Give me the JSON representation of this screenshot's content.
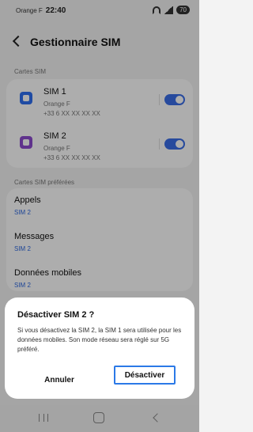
{
  "status_bar": {
    "carrier": "Orange F",
    "time": "22:40",
    "battery": "70"
  },
  "header": {
    "title": "Gestionnaire SIM"
  },
  "sections": {
    "sim_cards_label": "Cartes SIM",
    "preferred_label": "Cartes SIM préférées"
  },
  "sims": [
    {
      "name": "SIM 1",
      "carrier": "Orange F",
      "number": "+33 6 XX XX XX XX",
      "enabled": true,
      "icon": "sim-1-icon",
      "color": "#2f6ff0"
    },
    {
      "name": "SIM 2",
      "carrier": "Orange F",
      "number": "+33 6 XX XX XX XX",
      "enabled": true,
      "icon": "sim-2-icon",
      "color": "#8d4bcf"
    }
  ],
  "preferred": [
    {
      "label": "Appels",
      "value": "SIM 2"
    },
    {
      "label": "Messages",
      "value": "SIM 2"
    },
    {
      "label": "Données mobiles",
      "value": "SIM 2"
    }
  ],
  "dialog": {
    "title": "Désactiver SIM 2 ?",
    "text": "Si vous désactivez la SIM 2, la SIM 1 sera utilisée pour les données mobiles. Son mode réseau sera réglé sur 5G préféré.",
    "cancel_label": "Annuler",
    "confirm_label": "Désactiver"
  },
  "colors": {
    "accent": "#3a6de8",
    "value_text": "#2d67de",
    "focus_border": "#2b79e7"
  }
}
